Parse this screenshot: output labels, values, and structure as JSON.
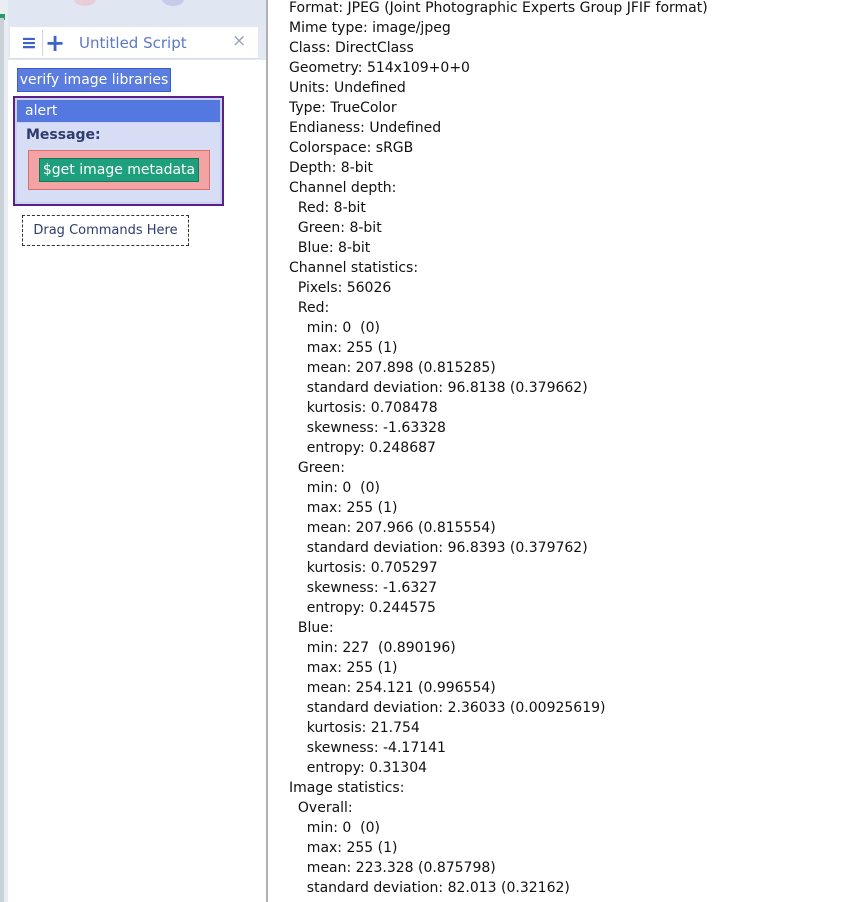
{
  "script_editor": {
    "tab_title": "Untitled Script",
    "menu_icon": "hamburger-icon",
    "add_icon": "plus-icon",
    "close_icon": "close-icon",
    "commands": {
      "verify_label": "verify image libraries",
      "alert": {
        "title": "alert",
        "message_label": "Message:",
        "message_value": "$get image metadata"
      },
      "drop_hint": "Drag Commands Here"
    }
  },
  "output": {
    "lines": [
      "Format: JPEG (Joint Photographic Experts Group JFIF format)",
      "Mime type: image/jpeg",
      "Class: DirectClass",
      "Geometry: 514x109+0+0",
      "Units: Undefined",
      "Type: TrueColor",
      "Endianess: Undefined",
      "Colorspace: sRGB",
      "Depth: 8-bit",
      "Channel depth:",
      "  Red: 8-bit",
      "  Green: 8-bit",
      "  Blue: 8-bit",
      "Channel statistics:",
      "  Pixels: 56026",
      "  Red:",
      "    min: 0  (0)",
      "    max: 255 (1)",
      "    mean: 207.898 (0.815285)",
      "    standard deviation: 96.8138 (0.379662)",
      "    kurtosis: 0.708478",
      "    skewness: -1.63328",
      "    entropy: 0.248687",
      "  Green:",
      "    min: 0  (0)",
      "    max: 255 (1)",
      "    mean: 207.966 (0.815554)",
      "    standard deviation: 96.8393 (0.379762)",
      "    kurtosis: 0.705297",
      "    skewness: -1.6327",
      "    entropy: 0.244575",
      "  Blue:",
      "    min: 227  (0.890196)",
      "    max: 255 (1)",
      "    mean: 254.121 (0.996554)",
      "    standard deviation: 2.36033 (0.00925619)",
      "    kurtosis: 21.754",
      "    skewness: -4.17141",
      "    entropy: 0.31304",
      "Image statistics:",
      "  Overall:",
      "    min: 0  (0)",
      "    max: 255 (1)",
      "    mean: 223.328 (0.875798)",
      "    standard deviation: 82.013 (0.32162)"
    ]
  },
  "colors": {
    "accent_blue": "#5b7de0",
    "alert_border": "#5b1e8a",
    "metadata_button": "#1fa07c",
    "message_slot": "#f3a3a3"
  }
}
